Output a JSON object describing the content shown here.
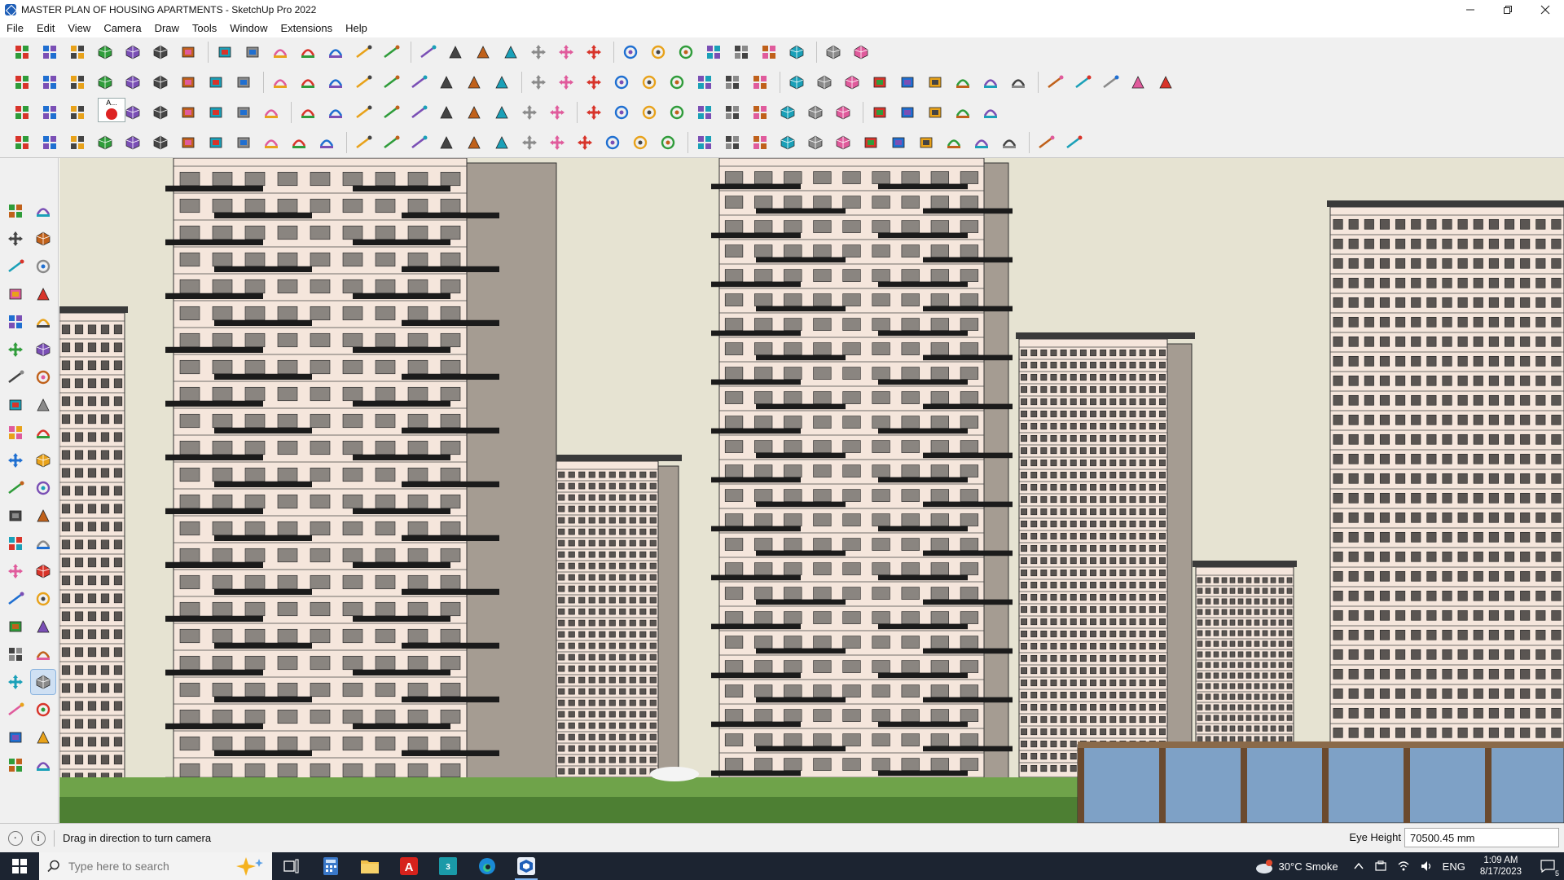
{
  "window": {
    "title": "MASTER PLAN OF HOUSING APARTMENTS - SketchUp Pro 2022",
    "controls": [
      "minimize",
      "restore",
      "close"
    ]
  },
  "menu": {
    "items": [
      "File",
      "Edit",
      "View",
      "Camera",
      "Draw",
      "Tools",
      "Window",
      "Extensions",
      "Help"
    ]
  },
  "toolbars": {
    "row1": [
      "zoom-extents",
      "select",
      "eraser",
      "line",
      "arc",
      "rectangle",
      "push-pull",
      "follow-me",
      "move",
      "rotate",
      "scale",
      "tape-measure",
      "text",
      "paint-bucket",
      "orbit",
      "pan",
      "zoom",
      "zoom-window",
      "components",
      "sandbox",
      "layers",
      "styles",
      "warehouse",
      "extension",
      "section-plane",
      "axes",
      "flip",
      "undo",
      "redo",
      "pin"
    ],
    "row2_count": 48,
    "row3_count": 40,
    "row4_count": 44,
    "mini_panel_label": "A..."
  },
  "left_palette": {
    "tools": [
      "select",
      "orbit",
      "paint-bucket",
      "eraser",
      "components",
      "tag",
      "line",
      "freehand",
      "rectangle",
      "rotated-rectangle",
      "circle",
      "polygon",
      "arc",
      "pie",
      "arc-3pt",
      "arc-2pt",
      "move",
      "push-pull",
      "rotate",
      "follow-me",
      "scale",
      "offset",
      "tape-measure",
      "dimension",
      "protractor",
      "text",
      "axes",
      "3d-text",
      "orbit-view",
      "pan-view",
      "zoom-view",
      "zoom-window",
      "zoom-extents",
      "previous-view",
      "walk",
      "look-around",
      "position-camera",
      "section-plane",
      "components-browser",
      "sandbox",
      "layers-panel",
      "styles-panel"
    ],
    "active_tool": "look-around"
  },
  "status": {
    "hint": "Drag in direction to turn camera",
    "measure_label": "Eye Height",
    "measure_value": "70500.45 mm"
  },
  "taskbar": {
    "search_placeholder": "Type here to search",
    "apps": [
      "task-view",
      "calculator",
      "file-explorer",
      "acrobat",
      "3ds-max",
      "edge",
      "sketchup"
    ],
    "weather": "30°C  Smoke",
    "language": "ENG",
    "time": "1:09 AM",
    "date": "8/17/2023",
    "notifications": "5"
  },
  "colors": {
    "sky": "#e6e3d2",
    "building_light": "#f5e6dc",
    "building_shadow": "#a59c92",
    "balcony": "#1b1b1b",
    "ground": "#6fa34a",
    "glass": "#7ea1c6",
    "toolbar_bg": "#f0f0f0",
    "taskbar_bg": "#1c2431"
  }
}
